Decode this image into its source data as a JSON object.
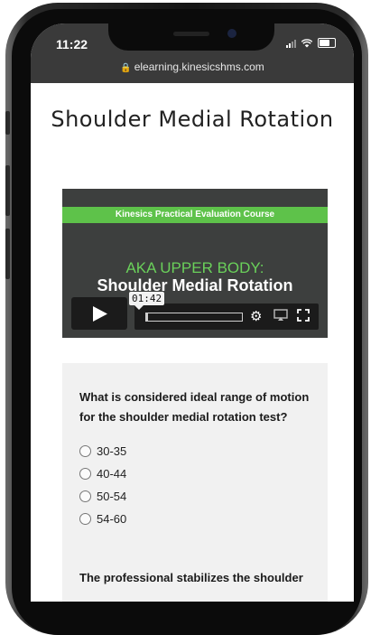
{
  "status_bar": {
    "time": "11:22"
  },
  "browser": {
    "url": "elearning.kinesicshms.com"
  },
  "page": {
    "title": "Shoulder Medial Rotation"
  },
  "video": {
    "banner": "Kinesics Practical Evaluation Course",
    "subtitle": "AKA UPPER BODY:",
    "title": "Shoulder Medial Rotation",
    "time_tooltip": "01:42",
    "progress": 0.02
  },
  "quiz": {
    "question": "What is considered ideal range of motion for the shoulder medial rotation test?",
    "options": [
      "30-35",
      "40-44",
      "50-54",
      "54-60"
    ],
    "next_question": "The professional stabilizes the shoulder"
  },
  "colors": {
    "accent_green": "#5ec24a",
    "video_bg": "#3d3f3e",
    "quiz_bg": "#f1f1f1"
  }
}
